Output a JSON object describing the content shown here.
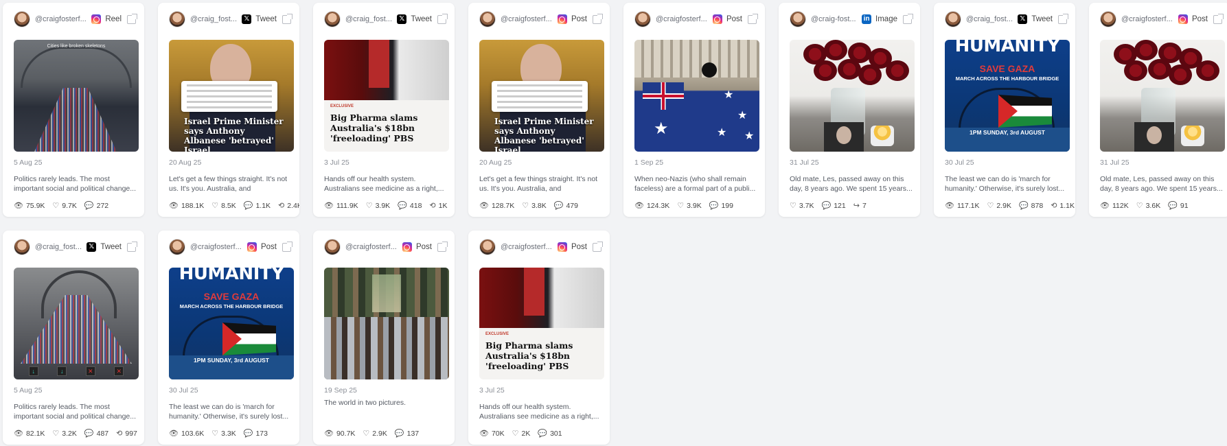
{
  "posts": [
    {
      "handle": "@craigfosterf...",
      "platform": "Reel",
      "platform_icon": "instagram-icon",
      "thumb": "bridge-crowd-video",
      "overlay": "Cities like broken skeletons",
      "date": "5 Aug 25",
      "caption": "Politics rarely leads. The most important social and political change...",
      "views": "75.9K",
      "likes": "9.7K",
      "comments": "272",
      "reposts": null
    },
    {
      "handle": "@craig_fost...",
      "platform": "Tweet",
      "platform_icon": "x-icon",
      "thumb": "netanyahu",
      "headline": "Israel Prime Minister says Anthony Albanese 'betrayed' Israel",
      "date": "20 Aug 25",
      "caption": "Let's get a few things straight. It's not us. It's you. Australia, and Australians,...",
      "views": "188.1K",
      "likes": "8.5K",
      "comments": "1.1K",
      "reposts": "2.4K"
    },
    {
      "handle": "@craig_fost...",
      "platform": "Tweet",
      "platform_icon": "x-icon",
      "thumb": "pharma",
      "tag": "EXCLUSIVE",
      "headline": "Big Pharma slams Australia's $18bn 'freeloading' PBS",
      "date": "3 Jul 25",
      "caption": "Hands off our health system. Australians see medicine as a right,...",
      "views": "111.9K",
      "likes": "3.9K",
      "comments": "418",
      "reposts": "1K"
    },
    {
      "handle": "@craigfosterf...",
      "platform": "Post",
      "platform_icon": "instagram-icon",
      "thumb": "netanyahu",
      "headline": "Israel Prime Minister says Anthony Albanese 'betrayed' Israel",
      "date": "20 Aug 25",
      "caption": "Let's get a few things straight. It's not us. It's you. Australia, and Australians,...",
      "views": "128.7K",
      "likes": "3.8K",
      "comments": "479",
      "reposts": null
    },
    {
      "handle": "@craigfosterf...",
      "platform": "Post",
      "platform_icon": "instagram-icon",
      "thumb": "flag",
      "date": "1 Sep 25",
      "caption": "When neo-Nazis (who shall remain faceless) are a formal part of a publi...",
      "views": "124.3K",
      "likes": "3.9K",
      "comments": "199",
      "reposts": null
    },
    {
      "handle": "@craig-fost...",
      "platform": "Image",
      "platform_icon": "linkedin-icon",
      "thumb": "roses",
      "date": "31 Jul 25",
      "caption": "Old mate, Les, passed away on this day, 8 years ago. We spent 15 years...",
      "views": null,
      "likes": "3.7K",
      "comments": "121",
      "shares": "7"
    },
    {
      "handle": "@craig_fost...",
      "platform": "Tweet",
      "platform_icon": "x-icon",
      "thumb": "march",
      "date": "30 Jul 25",
      "caption": "The least we can do is 'march for humanity.' Otherwise, it's surely lost...",
      "views": "117.1K",
      "likes": "2.9K",
      "comments": "878",
      "reposts": "1.1K"
    },
    {
      "handle": "@craigfosterf...",
      "platform": "Post",
      "platform_icon": "instagram-icon",
      "thumb": "roses",
      "date": "31 Jul 25",
      "caption": "Old mate, Les, passed away on this day, 8 years ago. We spent 15 years...",
      "views": "112K",
      "likes": "3.6K",
      "comments": "91",
      "reposts": null
    },
    {
      "handle": "@craig_fost...",
      "platform": "Tweet",
      "platform_icon": "x-icon",
      "thumb": "bridge-crowd",
      "date": "5 Aug 25",
      "caption": "Politics rarely leads. The most important social and political change...",
      "views": "82.1K",
      "likes": "3.2K",
      "comments": "487",
      "reposts": "997"
    },
    {
      "handle": "@craigfosterf...",
      "platform": "Post",
      "platform_icon": "instagram-icon",
      "thumb": "march",
      "date": "30 Jul 25",
      "caption": "The least we can do is 'march for humanity.' Otherwise, it's surely lost...",
      "views": "103.6K",
      "likes": "3.3K",
      "comments": "173",
      "reposts": null
    },
    {
      "handle": "@craigfosterf...",
      "platform": "Post",
      "platform_icon": "instagram-icon",
      "thumb": "two-pictures",
      "date": "19 Sep 25",
      "caption": "The world in two pictures.",
      "views": "90.7K",
      "likes": "2.9K",
      "comments": "137",
      "reposts": null
    },
    {
      "handle": "@craigfosterf...",
      "platform": "Post",
      "platform_icon": "instagram-icon",
      "thumb": "pharma",
      "tag": "EXCLUSIVE",
      "headline": "Big Pharma slams Australia's $18bn 'freeloading' PBS",
      "date": "3 Jul 25",
      "caption": "Hands off our health system. Australians see medicine as a right,...",
      "views": "70K",
      "likes": "2K",
      "comments": "301",
      "reposts": null
    }
  ],
  "march": {
    "title": "HUMANITY",
    "gaza": "SAVE GAZA",
    "sub": "MARCH ACROSS THE HARBOUR BRIDGE",
    "when": "1PM SUNDAY, 3rd AUGUST"
  }
}
